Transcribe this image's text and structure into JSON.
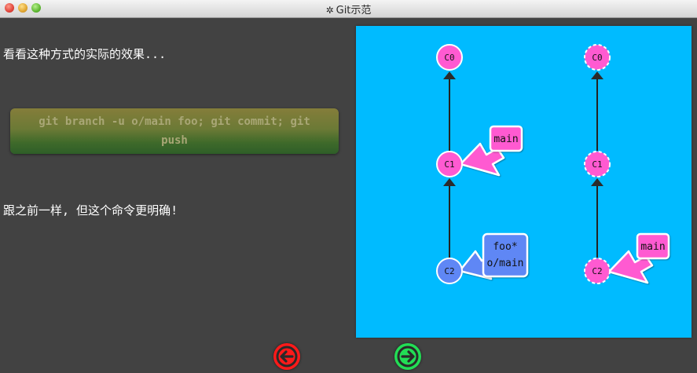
{
  "window": {
    "title": "Git示范"
  },
  "left": {
    "intro": "看看这种方式的实际的效果...",
    "command_line1": "git branch -u o/main foo; git commit; git",
    "command_line2": "push",
    "note": "跟之前一样, 但这个命令更明确!"
  },
  "graph": {
    "local": {
      "commits": [
        "C0",
        "C1",
        "C2"
      ],
      "branch_main": "main",
      "branch_foo": "foo*",
      "branch_origin": "o/main"
    },
    "remote": {
      "commits": [
        "C0",
        "C1",
        "C2"
      ],
      "branch_main": "main"
    }
  },
  "colors": {
    "canvas": "#00bbff",
    "commit_local": "#ff5ad1",
    "commit_head": "#5f87f5",
    "label_pink": "#ff5ad1",
    "label_blue": "#5f87f5"
  },
  "icons": {
    "title": "gear-icon",
    "back": "arrow-left-icon",
    "forward": "arrow-right-icon"
  }
}
